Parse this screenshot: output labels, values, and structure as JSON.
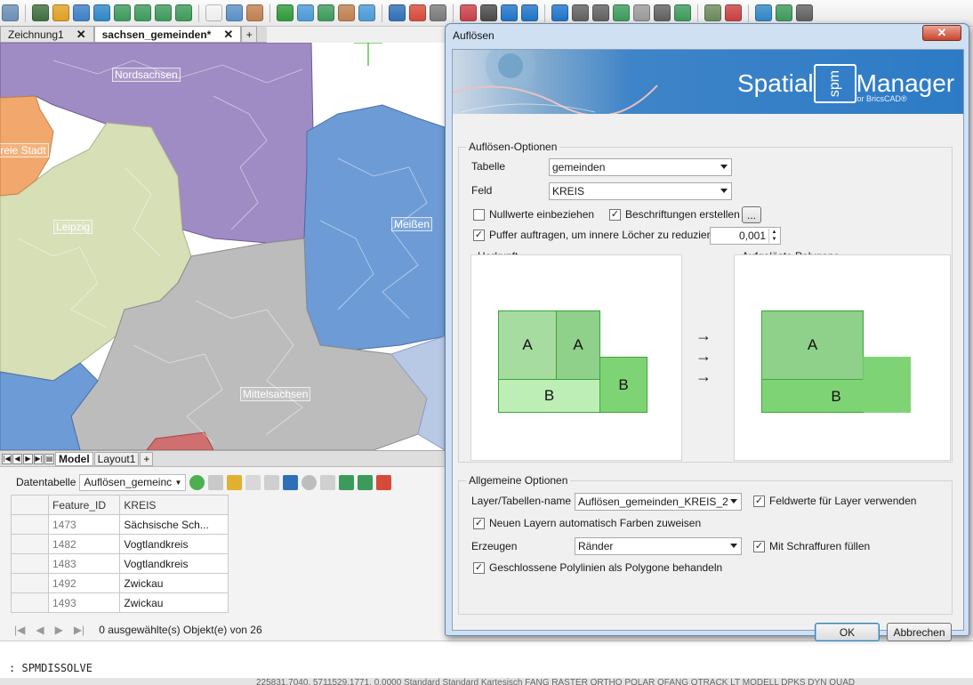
{
  "app": {
    "doc_tabs": [
      {
        "label": "Zeichnung1",
        "close": "✕"
      },
      {
        "label": "sachsen_gemeinden*",
        "close": "✕"
      }
    ],
    "doc_tab_add": "+",
    "layout_tabs": [
      "Model",
      "Layout1"
    ],
    "layout_tab_add": "+"
  },
  "map": {
    "labels": [
      "Nordsachsen",
      "Freie Stadt",
      "Leipzig",
      "Meißen",
      "Mittelsachsen"
    ],
    "colors": {
      "purple": "#a08cc4",
      "green": "#d6dfb6",
      "orange": "#f2a86c",
      "blue": "#6d9bd6",
      "gray": "#bcbcbc",
      "red": "#cf6f6f"
    }
  },
  "datatable": {
    "label": "Datentabelle",
    "layer": "Auflösen_gemeinc",
    "columns": [
      "Feature_ID",
      "KREIS"
    ],
    "rows": [
      [
        "1473",
        "Sächsische Sch..."
      ],
      [
        "1482",
        "Vogtlandkreis"
      ],
      [
        "1483",
        "Vogtlandkreis"
      ],
      [
        "1492",
        "Zwickau"
      ],
      [
        "1493",
        "Zwickau"
      ]
    ],
    "selection_count": "0 ausgewählte(s) Objekt(e) von 26"
  },
  "command": {
    "text": "SPMDISSOLVE",
    "prompt": ":"
  },
  "status": {
    "text": "225831.7040, 5711529.1771, 0.0000   Standard   Standard   Kartesisch   FANG   RASTER   ORTHO   POLAR   OFANG   OTRACK   LT   MODELL   DPKS   DYN   QUAD"
  },
  "dialog": {
    "title": "Auflösen",
    "close": "✕",
    "banner": {
      "brand": "Spatial",
      "box": "spm",
      "product": "Manager",
      "sub": "for BricsCAD®"
    },
    "options_group": "Auflösen-Optionen",
    "table_label": "Tabelle",
    "table_value": "gemeinden",
    "field_label": "Feld",
    "field_value": "KREIS",
    "chk_nullwerte": "Nullwerte einbeziehen",
    "chk_beschriftungen": "Beschriftungen erstellen",
    "ellipsis": "...",
    "chk_puffer": "Puffer auftragen, um innere Löcher zu reduzieren",
    "puffer_value": "0,001",
    "herkunft": "Herkunft",
    "aufgeloeste": "Aufgelöste Polygone",
    "diagram": {
      "a": "A",
      "b": "B",
      "arrow": "→"
    },
    "general_group": "Allgemeine Optionen",
    "layername_label": "Layer/Tabellen-name",
    "layername_value": "Auflösen_gemeinden_KREIS_2",
    "chk_feldwerte": "Feldwerte für Layer verwenden",
    "chk_farben": "Neuen Layern automatisch Farben zuweisen",
    "erzeugen_label": "Erzeugen",
    "erzeugen_value": "Ränder",
    "chk_schraffuren": "Mit Schraffuren füllen",
    "chk_polylinien": "Geschlossene Polylinien als Polygone behandeln",
    "ok": "OK",
    "cancel": "Abbrechen",
    "checks": {
      "nullwerte": false,
      "beschriftungen": true,
      "puffer": true,
      "feldwerte": true,
      "farben": true,
      "schraffuren": true,
      "polylinien": true
    },
    "check_mark": "✓"
  },
  "toolbar": {
    "icons": [
      "layer-icon",
      "camera-icon",
      "person-icon",
      "pin-icon",
      "pen-icon",
      "select-icon",
      "select-add-icon",
      "select-remove-icon",
      "zoom-icon",
      "bug-icon",
      "wave-icon",
      "landscape-icon",
      "plus-icon",
      "area-icon",
      "area2-icon",
      "area3-icon",
      "snow-icon",
      "table-icon",
      "pencil-icon",
      "clip-icon",
      "clear-icon",
      "tools-icon",
      "help-icon",
      "refresh-icon",
      "info-icon",
      "doc-icon",
      "doc2-icon",
      "export-icon",
      "circles-icon",
      "link-icon",
      "image-icon",
      "map-icon",
      "xy-icon",
      "photo-icon",
      "photo2-icon",
      "expand-icon"
    ]
  }
}
